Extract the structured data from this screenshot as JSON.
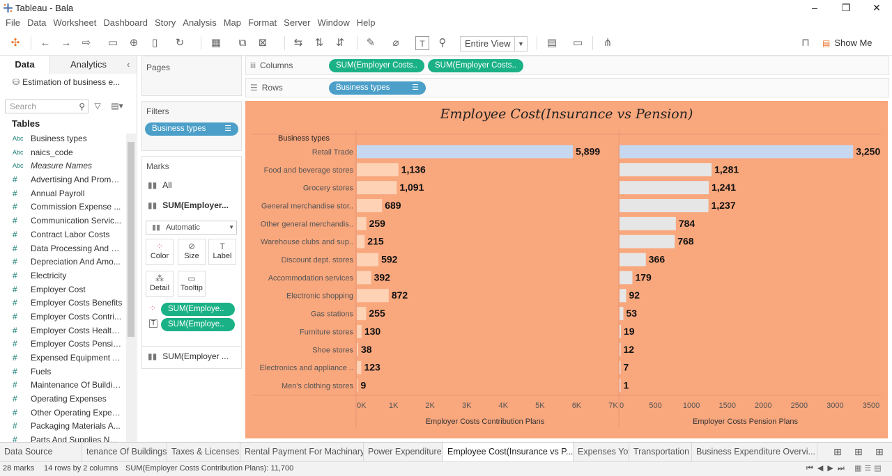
{
  "window": {
    "title": "Tableau - Bala"
  },
  "menu": [
    "File",
    "Data",
    "Worksheet",
    "Dashboard",
    "Story",
    "Analysis",
    "Map",
    "Format",
    "Server",
    "Window",
    "Help"
  ],
  "toolbar": {
    "fit": "Entire View",
    "show_me": "Show Me"
  },
  "data_pane": {
    "tab_data": "Data",
    "tab_analytics": "Analytics",
    "datasource": "Estimation of business e...",
    "search_placeholder": "Search",
    "tables_heading": "Tables",
    "fields": [
      {
        "type": "Abc",
        "name": "Business types"
      },
      {
        "type": "Abc",
        "name": "naics_code"
      },
      {
        "type": "Abc",
        "name": "Measure Names",
        "italic": true
      },
      {
        "type": "#",
        "name": "Advertising And Promo..."
      },
      {
        "type": "#",
        "name": "Annual Payroll"
      },
      {
        "type": "#",
        "name": "Commission Expense ..."
      },
      {
        "type": "#",
        "name": "Communication Servic..."
      },
      {
        "type": "#",
        "name": "Contract Labor Costs"
      },
      {
        "type": "#",
        "name": "Data Processing And C..."
      },
      {
        "type": "#",
        "name": "Depreciation And Amo..."
      },
      {
        "type": "#",
        "name": "Electricity"
      },
      {
        "type": "#",
        "name": "Employer Cost"
      },
      {
        "type": "#",
        "name": "Employer Costs Benefits"
      },
      {
        "type": "#",
        "name": "Employer Costs Contri..."
      },
      {
        "type": "#",
        "name": "Employer Costs Health..."
      },
      {
        "type": "#",
        "name": "Employer Costs Pensio..."
      },
      {
        "type": "#",
        "name": "Expensed Equipment A..."
      },
      {
        "type": "#",
        "name": "Fuels"
      },
      {
        "type": "#",
        "name": "Maintenance Of Buildin..."
      },
      {
        "type": "#",
        "name": "Operating Expenses"
      },
      {
        "type": "#",
        "name": "Other Operating Expen..."
      },
      {
        "type": "#",
        "name": "Packaging Materials A..."
      },
      {
        "type": "#",
        "name": "Parts And Supplies Not..."
      }
    ]
  },
  "cards": {
    "pages": "Pages",
    "filters": "Filters",
    "filter_pill": "Business types",
    "marks": "Marks",
    "marks_all": "All",
    "marks_sum1": "SUM(Employer...",
    "mark_type": "Automatic",
    "btn_color": "Color",
    "btn_size": "Size",
    "btn_label": "Label",
    "btn_detail": "Detail",
    "btn_tooltip": "Tooltip",
    "enc_pill1": "SUM(Employe..",
    "enc_pill2": "SUM(Employe..",
    "marks_sum2": "SUM(Employer ..."
  },
  "shelves": {
    "columns_label": "Columns",
    "columns_pill1": "SUM(Employer Costs..",
    "columns_pill2": "SUM(Employer Costs..",
    "rows_label": "Rows",
    "rows_pill": "Business types"
  },
  "chart_data": {
    "type": "bar",
    "title": "Employee Cost(Insurance vs Pension)",
    "row_header": "Business types",
    "categories": [
      "Retail Trade",
      "Food and beverage stores",
      "Grocery stores",
      "General merchandise stor..",
      "Other general merchandis..",
      "Warehouse clubs and sup..",
      "Discount dept. stores",
      "Accommodation services",
      "Electronic shopping",
      "Gas stations",
      "Furniture stores",
      "Shoe stores",
      "Electronics and appliance ..",
      "Men's clothing stores"
    ],
    "series": [
      {
        "name": "Employer Costs Contribution Plans",
        "values": [
          5899,
          1136,
          1091,
          689,
          259,
          215,
          592,
          392,
          872,
          255,
          130,
          38,
          123,
          9
        ],
        "labels": [
          "5,899",
          "1,136",
          "1,091",
          "689",
          "259",
          "215",
          "592",
          "392",
          "872",
          "255",
          "130",
          "38",
          "123",
          "9"
        ],
        "ticks": [
          "0K",
          "1K",
          "2K",
          "3K",
          "4K",
          "5K",
          "6K",
          "7K"
        ],
        "xlim": [
          0,
          7000
        ]
      },
      {
        "name": "Employer Costs Pension Plans",
        "values": [
          3250,
          1281,
          1241,
          1237,
          784,
          768,
          366,
          179,
          92,
          53,
          19,
          12,
          7,
          1
        ],
        "labels": [
          "3,250",
          "1,281",
          "1,241",
          "1,237",
          "784",
          "768",
          "366",
          "179",
          "92",
          "53",
          "19",
          "12",
          "7",
          "1"
        ],
        "ticks": [
          "0",
          "500",
          "1000",
          "1500",
          "2000",
          "2500",
          "3000",
          "3500"
        ],
        "xlim": [
          0,
          3500
        ]
      }
    ],
    "colors": {
      "background": "#f9a77d",
      "highlight": "#c6d7f0",
      "series1": "#fdd2b5",
      "series2": "#e6e6e6"
    }
  },
  "sheet_tabs": [
    "Data Source",
    "tenance Of Buildings",
    "Taxes & Licenses",
    "Rental Payment For Machinary",
    "Power Expenditure",
    "Employee Cost(Insurance vs P...",
    "Expenses Yoy",
    "Transportation",
    "Business Expenditure Overvi..."
  ],
  "status": {
    "marks": "28 marks",
    "rows": "14 rows by 2 columns",
    "sum": "SUM(Employer Costs Contribution Plans): 11,700"
  }
}
